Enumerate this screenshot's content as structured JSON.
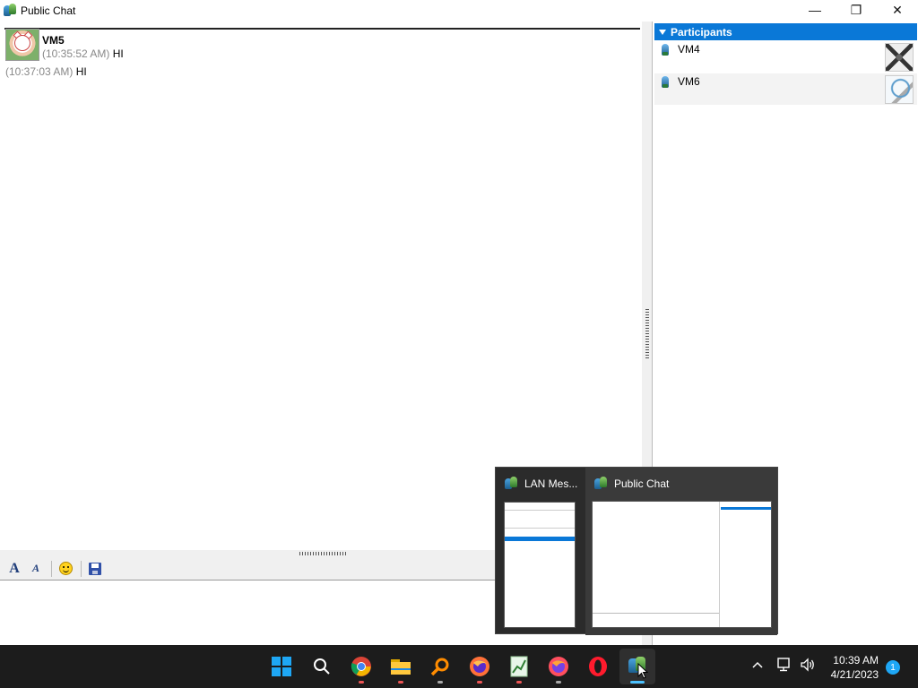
{
  "window": {
    "title": "Public Chat",
    "minimize": "—",
    "restore": "❐",
    "close": "✕"
  },
  "chat": {
    "sender": "VM5",
    "messages": [
      {
        "time": "(10:35:52 AM)",
        "text": "HI"
      },
      {
        "time": "(10:37:03 AM)",
        "text": "HI"
      }
    ]
  },
  "participants": {
    "header": "Participants",
    "items": [
      {
        "name": "VM4"
      },
      {
        "name": "VM6"
      }
    ]
  },
  "toolbar": {
    "font_glyph": "A",
    "font_color_glyph": "A"
  },
  "taskview": {
    "items": [
      {
        "title": "LAN Mes..."
      },
      {
        "title": "Public Chat"
      }
    ]
  },
  "taskbar": {
    "time": "10:39 AM",
    "date": "4/21/2023",
    "notification_count": "1"
  },
  "colors": {
    "accent": "#0a78d7",
    "taskbar": "#1c1c1c"
  }
}
